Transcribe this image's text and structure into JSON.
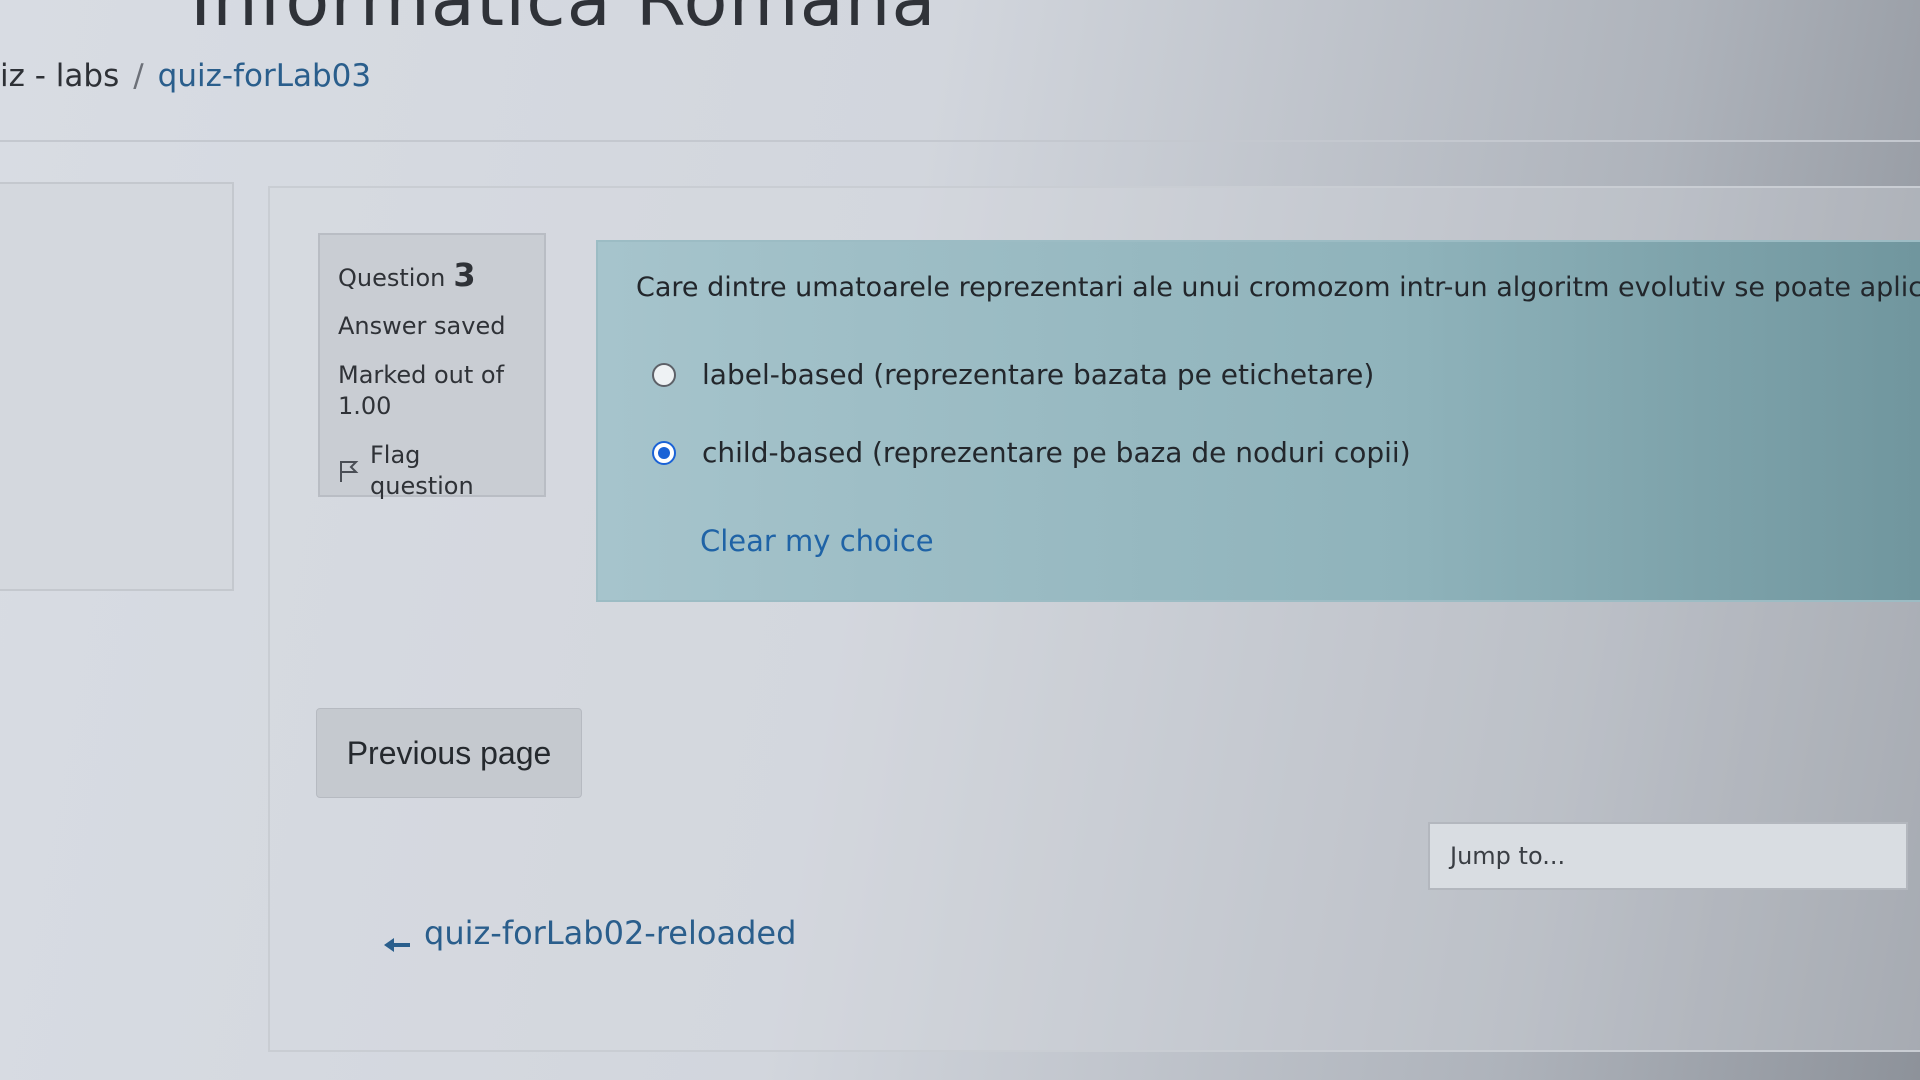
{
  "site": {
    "title": "Informatica Romana"
  },
  "breadcrumb": {
    "parent": "iz - labs",
    "separator": "/",
    "current": "quiz-forLab03"
  },
  "question_info": {
    "label": "Question",
    "number": "3",
    "state": "Answer saved",
    "grade": "Marked out of 1.00",
    "flag_label": "Flag question",
    "flag_icon": "flag-icon"
  },
  "question": {
    "text": "Care dintre umatoarele reprezentari ale unui cromozom intr-un algoritm evolutiv se poate aplica pentu problema de detect",
    "options": [
      {
        "label": "label-based (reprezentare bazata pe etichetare)",
        "checked": false
      },
      {
        "label": "child-based (reprezentare pe baza de noduri copii)",
        "checked": true
      }
    ],
    "clear_label": "Clear my choice"
  },
  "navigation": {
    "previous_button": "Previous page",
    "jump_placeholder": "Jump to...",
    "previous_activity": "quiz-forLab02-reloaded",
    "previous_activity_icon": "arrow-left-icon"
  },
  "colors": {
    "link": "#2a5e8c",
    "radio_checked": "#1a62d6",
    "formulation_bg": "#a6c4cc"
  }
}
